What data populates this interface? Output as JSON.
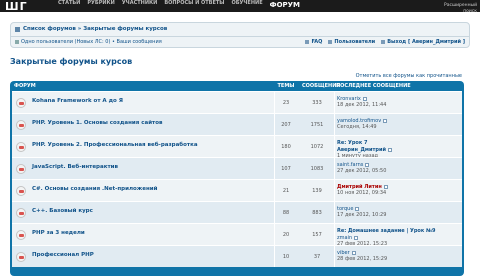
{
  "topbar": {
    "logo": "ШГ",
    "nav": [
      "СТАТЬИ",
      "РУБРИКИ",
      "УЧАСТНИКИ",
      "ВОПРОСЫ И ОТВЕТЫ",
      "ОБУЧЕНИЕ",
      "ФОРУМ"
    ],
    "extended_search": "Расширенный поиск"
  },
  "navbar": {
    "breadcrumb": "Список форумов » Закрытые форумы курсов",
    "online": "Одно пользователи (Новых ЛС: 0) • Ваши сообщения",
    "links": [
      "FAQ",
      "Пользователи",
      "Выход [ Аверин_Дмитрий ]"
    ]
  },
  "page": {
    "heading": "Закрытые форумы курсов",
    "mark_read": "Отметить все форумы как прочитанные"
  },
  "table": {
    "headers": {
      "forum": "ФОРУМ",
      "topics": "ТЕМЫ",
      "posts": "СООБЩЕНИЯ",
      "last": "ПОСЛЕДНЕЕ СООБЩЕНИЕ"
    },
    "rows": [
      {
        "title": "Kohana Framework от А до Я",
        "topics": "23",
        "posts": "333",
        "last_title": "",
        "last_author": "Kronvarix",
        "last_time": "18 дек 2012, 11:44"
      },
      {
        "title": "PHP. Уровень 1. Основы создания сайтов",
        "topics": "207",
        "posts": "1751",
        "last_title": "",
        "last_author": "yamolod.trofimov",
        "last_time": "Сегодня, 14:49"
      },
      {
        "title": "PHP. Уровень 2. Профессиональная веб-разработка",
        "topics": "180",
        "posts": "1072",
        "last_title": "Re: Урок 7",
        "last_author": "Аверин_Дмитрий",
        "last_time": "1 минуту назад"
      },
      {
        "title": "JavaScript. Веб-интерактив",
        "topics": "107",
        "posts": "1083",
        "last_title": "",
        "last_author": "saint.farns",
        "last_time": "27 дек 2012, 05:50"
      },
      {
        "title": "C#. Основы создания .Net-приложений",
        "topics": "21",
        "posts": "139",
        "last_title": "",
        "last_author": "Дмитрий Литин",
        "last_time": "10 ноя 2012, 09:34"
      },
      {
        "title": "C++. Базовый курс",
        "topics": "88",
        "posts": "883",
        "last_title": "",
        "last_author": "torque",
        "last_time": "17 дек 2012, 10:29"
      },
      {
        "title": "PHP за 3 недели",
        "topics": "20",
        "posts": "157",
        "last_title": "Re: Домашнее задание | Урок №9",
        "last_author": "zmain",
        "last_time": "27 фев 2012, 15:23"
      },
      {
        "title": "Профессионал PHP",
        "topics": "10",
        "posts": "37",
        "last_title": "",
        "last_author": "viber",
        "last_time": "28 фев 2012, 15:29"
      }
    ]
  }
}
